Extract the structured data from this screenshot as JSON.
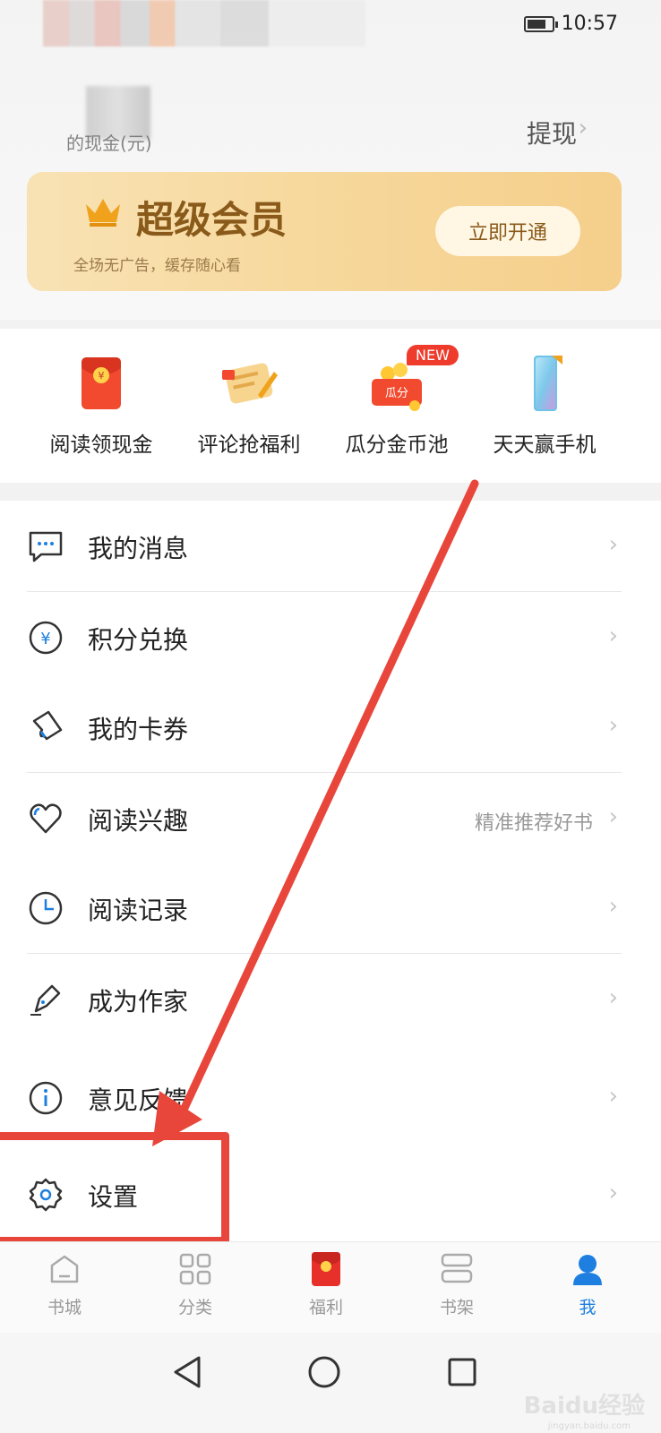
{
  "status_bar": {
    "time": "10:57"
  },
  "account": {
    "balance_label": "的现金(元)",
    "withdraw": "提现"
  },
  "vip_banner": {
    "title": "超级会员",
    "subtitle": "全场无广告，缓存随心看",
    "button": "立即开通",
    "accent": "#8a5a1a"
  },
  "promos": [
    {
      "label": "阅读领现金",
      "icon": "red-envelope-icon"
    },
    {
      "label": "评论抢福利",
      "icon": "comment-scroll-icon"
    },
    {
      "label": "瓜分金币池",
      "icon": "coin-pool-icon",
      "badge": "NEW",
      "badge_text_inner": "瓜分"
    },
    {
      "label": "天天赢手机",
      "icon": "phone-icon"
    }
  ],
  "menu": [
    {
      "label": "我的消息",
      "icon": "message-icon",
      "hint": ""
    },
    {
      "label": "积分兑换",
      "icon": "yuan-coin-icon",
      "hint": ""
    },
    {
      "label": "我的卡券",
      "icon": "ticket-icon",
      "hint": ""
    },
    {
      "label": "阅读兴趣",
      "icon": "heart-icon",
      "hint": "精准推荐好书"
    },
    {
      "label": "阅读记录",
      "icon": "clock-icon",
      "hint": ""
    },
    {
      "label": "成为作家",
      "icon": "pen-icon",
      "hint": ""
    },
    {
      "label": "意见反馈",
      "icon": "info-icon",
      "hint": ""
    },
    {
      "label": "设置",
      "icon": "gear-icon",
      "hint": ""
    }
  ],
  "tabs": [
    {
      "label": "书城",
      "icon": "home-icon",
      "active": false
    },
    {
      "label": "分类",
      "icon": "grid-icon",
      "active": false
    },
    {
      "label": "福利",
      "icon": "red-envelope-icon",
      "active": false
    },
    {
      "label": "书架",
      "icon": "bookshelf-icon",
      "active": false
    },
    {
      "label": "我",
      "icon": "user-icon",
      "active": true
    }
  ],
  "watermark": {
    "text": "Baidu经验",
    "sub": "jingyan.baidu.com"
  },
  "annotation_color": "#e8463b",
  "active_color": "#1e7fe0"
}
